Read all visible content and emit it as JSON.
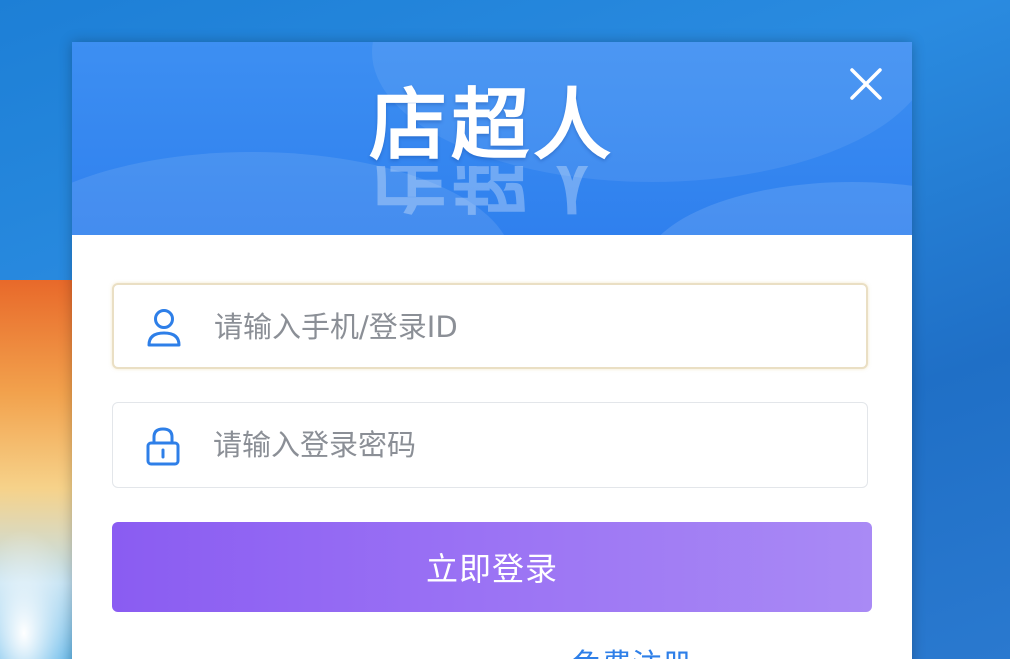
{
  "app": {
    "brand_name": "店超人"
  },
  "login": {
    "account_placeholder": "请输入手机/登录ID",
    "password_placeholder": "请输入登录密码",
    "submit_label": "立即登录"
  },
  "footer": {
    "register_link": "免费注册"
  },
  "colors": {
    "header_blue": "#2f80ee",
    "button_purple": "#9b73f4",
    "icon_blue": "#2e7fe8",
    "link_blue": "#2e7fe8"
  },
  "icons": {
    "close": "close-icon",
    "user": "user-icon",
    "lock": "lock-icon"
  }
}
